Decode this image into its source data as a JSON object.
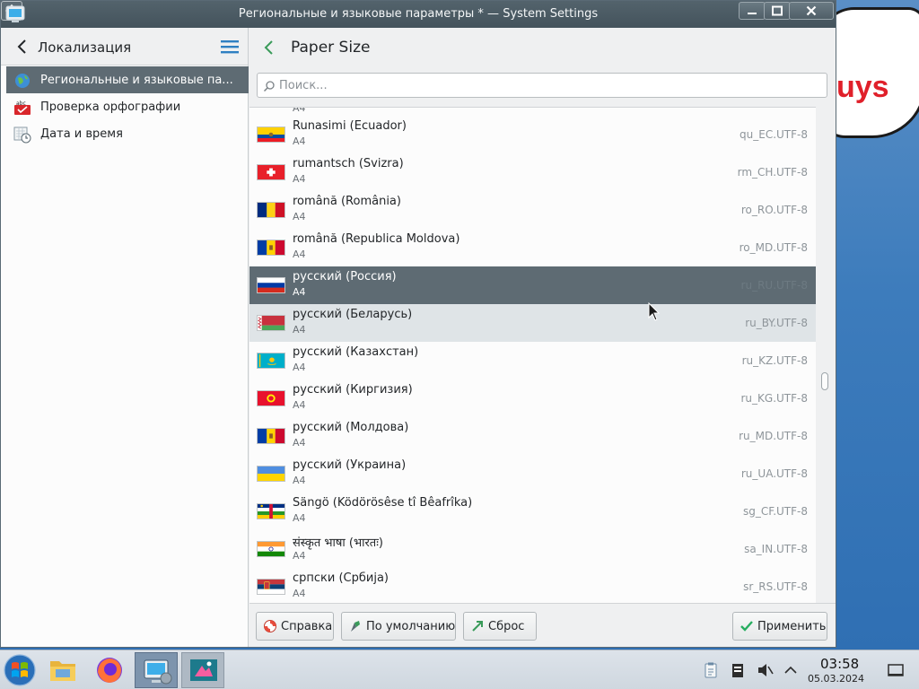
{
  "window": {
    "title": "Региональные и языковые параметры * — System Settings"
  },
  "sidebar": {
    "title": "Локализация",
    "items": [
      {
        "label": "Региональные и языковые па...",
        "icon": "globe-icon",
        "active": true
      },
      {
        "label": "Проверка орфографии",
        "icon": "spellcheck-icon",
        "active": false
      },
      {
        "label": "Дата и время",
        "icon": "calendar-clock-icon",
        "active": false
      }
    ]
  },
  "main": {
    "title": "Paper Size",
    "search": {
      "placeholder": "Поиск...",
      "value": ""
    },
    "top_fragment": "A4",
    "rows": [
      {
        "name": "Runasimi (Ecuador)",
        "paper": "A4",
        "code": "qu_EC.UTF-8",
        "flag": "ecuador-flag-icon",
        "state": ""
      },
      {
        "name": "rumantsch (Svizra)",
        "paper": "A4",
        "code": "rm_CH.UTF-8",
        "flag": "switzerland-flag-icon",
        "state": ""
      },
      {
        "name": "română (România)",
        "paper": "A4",
        "code": "ro_RO.UTF-8",
        "flag": "romania-flag-icon",
        "state": ""
      },
      {
        "name": "română (Republica Moldova)",
        "paper": "A4",
        "code": "ro_MD.UTF-8",
        "flag": "moldova-flag-icon",
        "state": ""
      },
      {
        "name": "русский (Россия)",
        "paper": "A4",
        "code": "ru_RU.UTF-8",
        "flag": "russia-flag-icon",
        "state": "selected"
      },
      {
        "name": "русский (Беларусь)",
        "paper": "A4",
        "code": "ru_BY.UTF-8",
        "flag": "belarus-flag-icon",
        "state": "hover"
      },
      {
        "name": "русский (Казахстан)",
        "paper": "A4",
        "code": "ru_KZ.UTF-8",
        "flag": "kazakhstan-flag-icon",
        "state": ""
      },
      {
        "name": "русский (Киргизия)",
        "paper": "A4",
        "code": "ru_KG.UTF-8",
        "flag": "kyrgyzstan-flag-icon",
        "state": ""
      },
      {
        "name": "русский (Молдова)",
        "paper": "A4",
        "code": "ru_MD.UTF-8",
        "flag": "moldova-flag-icon",
        "state": ""
      },
      {
        "name": "русский (Украина)",
        "paper": "A4",
        "code": "ru_UA.UTF-8",
        "flag": "ukraine-flag-icon",
        "state": ""
      },
      {
        "name": "Sängö (Ködörösêse tî Bêafrîka)",
        "paper": "A4",
        "code": "sg_CF.UTF-8",
        "flag": "central-african-republic-flag-icon",
        "state": ""
      },
      {
        "name": "संस्कृत भाषा (भारतः)",
        "paper": "A4",
        "code": "sa_IN.UTF-8",
        "flag": "india-flag-icon",
        "state": ""
      },
      {
        "name": "српски (Србија)",
        "paper": "A4",
        "code": "sr_RS.UTF-8",
        "flag": "serbia-flag-icon",
        "state": ""
      }
    ]
  },
  "buttons": {
    "help": "Справка",
    "defaults": "По умолчанию",
    "reset": "Сброс",
    "apply": "Применить"
  },
  "desktop": {
    "bubble_text": "uys"
  },
  "taskbar": {
    "time": "03:58",
    "date": "05.03.2024"
  },
  "colors": {
    "selection": "#5e6b73",
    "hover": "#dfe4e7",
    "titlebar": "#4a5961",
    "accent": "#3daee9"
  }
}
